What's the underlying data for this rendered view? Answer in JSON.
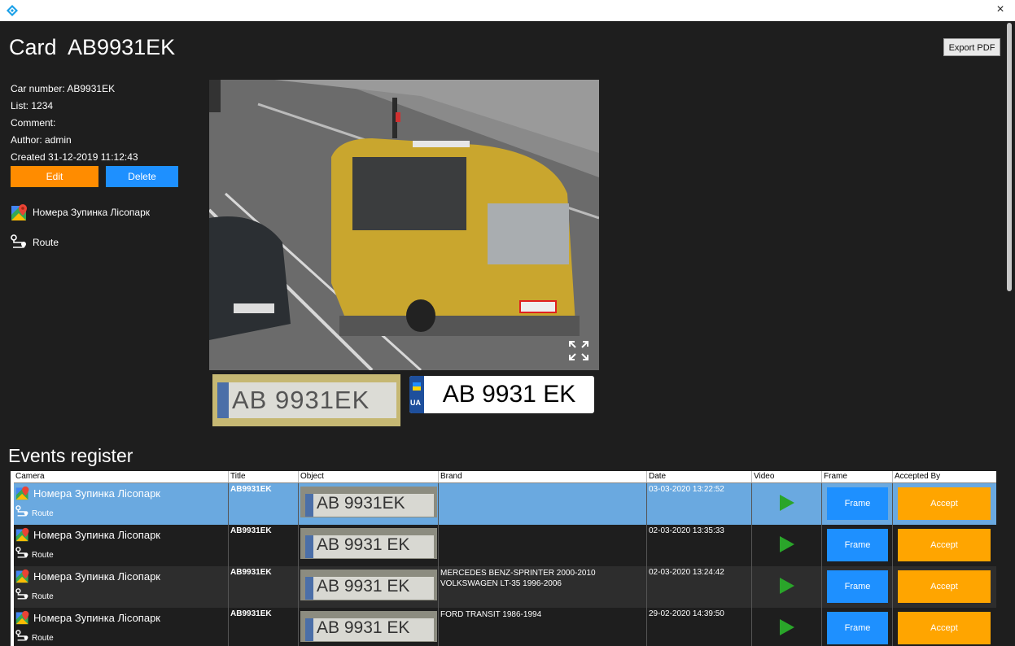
{
  "window": {
    "close_glyph": "×"
  },
  "header": {
    "title": "Card  AB9931EK",
    "export_label": "Export PDF"
  },
  "info": {
    "car_number": "Car number: AB9931EK",
    "list": "List: 1234",
    "comment": "Comment:",
    "author": "Author: admin",
    "created": "Created 31-12-2019 11:12:43"
  },
  "actions": {
    "edit_label": "Edit",
    "delete_label": "Delete"
  },
  "location": {
    "camera_name": "Номера Зупинка Лісопарк",
    "route_label": "Route"
  },
  "plate": {
    "country_code": "UA",
    "number": "AB 9931 EK",
    "crop_text": "AB 9931EK"
  },
  "events": {
    "title": "Events register",
    "columns": [
      "Camera",
      "Title",
      "Object",
      "Brand",
      "Date",
      "Video",
      "Frame",
      "Accepted By"
    ],
    "rows": [
      {
        "camera": "Номера Зупинка Лісопарк",
        "route": "Route",
        "title": "AB9931EK",
        "object": "AB 9931EK",
        "brand": "",
        "date": "03-03-2020 13:22:52",
        "frame": "Frame",
        "accept": "Accept"
      },
      {
        "camera": "Номера Зупинка Лісопарк",
        "route": "Route",
        "title": "AB9931EK",
        "object": "AB 9931 EK",
        "brand": "",
        "date": "02-03-2020 13:35:33",
        "frame": "Frame",
        "accept": "Accept"
      },
      {
        "camera": "Номера Зупинка Лісопарк",
        "route": "Route",
        "title": "AB9931EK",
        "object": "AB 9931 EK",
        "brand": "MERCEDES BENZ-SPRINTER 2000-2010\nVOLKSWAGEN LT-35 1996-2006",
        "date": "02-03-2020 13:24:42",
        "frame": "Frame",
        "accept": "Accept"
      },
      {
        "camera": "Номера Зупинка Лісопарк",
        "route": "Route",
        "title": "AB9931EK",
        "object": "AB 9931 EK",
        "brand": "FORD TRANSIT 1986-1994",
        "date": "29-02-2020 14:39:50",
        "frame": "Frame",
        "accept": "Accept"
      }
    ]
  },
  "colors": {
    "edit": "#ff8c00",
    "delete": "#1e90ff",
    "frame": "#1e90ff",
    "accept": "#ffa500",
    "selected_row": "#6aa9e0",
    "play": "#2aa52a"
  }
}
